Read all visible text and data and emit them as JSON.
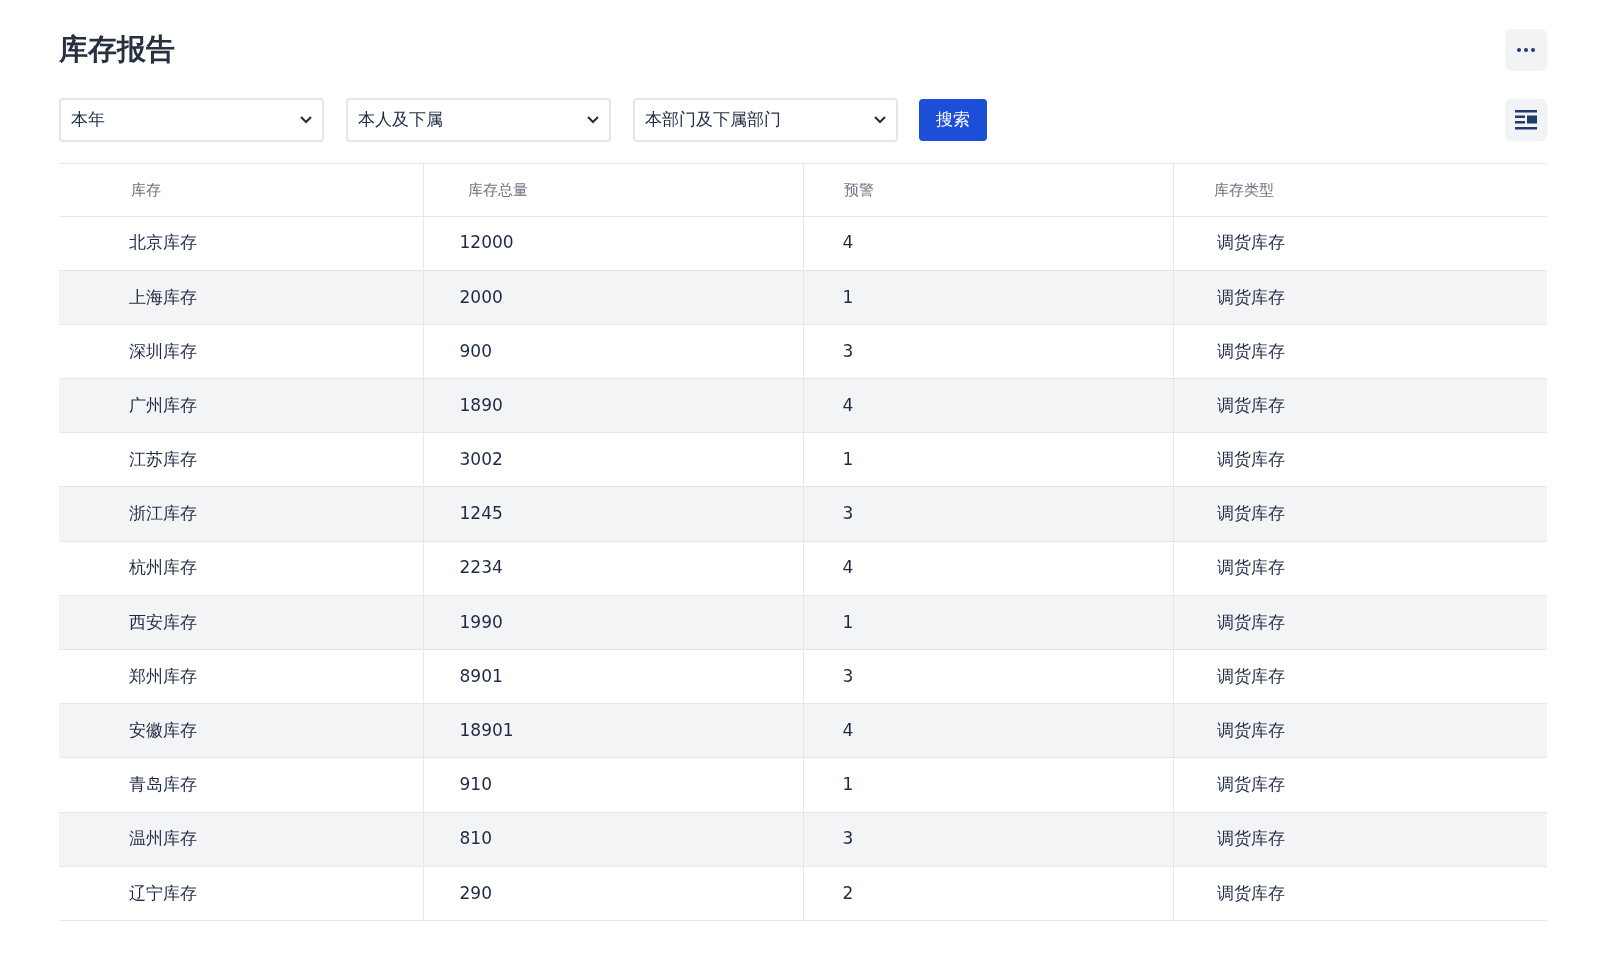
{
  "title": "库存报告",
  "filters": [
    {
      "value": "本年"
    },
    {
      "value": "本人及下属"
    },
    {
      "value": "本部门及下属部门"
    }
  ],
  "search_button": "搜索",
  "table": {
    "columns": [
      "库存",
      "库存总量",
      "预警",
      "库存类型"
    ],
    "rows": [
      [
        "北京库存",
        "12000",
        "4",
        "调货库存"
      ],
      [
        "上海库存",
        "2000",
        "1",
        "调货库存"
      ],
      [
        "深圳库存",
        "900",
        "3",
        "调货库存"
      ],
      [
        "广州库存",
        "1890",
        "4",
        "调货库存"
      ],
      [
        "江苏库存",
        "3002",
        "1",
        "调货库存"
      ],
      [
        "浙江库存",
        "1245",
        "3",
        "调货库存"
      ],
      [
        "杭州库存",
        "2234",
        "4",
        "调货库存"
      ],
      [
        "西安库存",
        "1990",
        "1",
        "调货库存"
      ],
      [
        "郑州库存",
        "8901",
        "3",
        "调货库存"
      ],
      [
        "安徽库存",
        "18901",
        "4",
        "调货库存"
      ],
      [
        "青岛库存",
        "910",
        "1",
        "调货库存"
      ],
      [
        "温州库存",
        "810",
        "3",
        "调货库存"
      ],
      [
        "辽宁库存",
        "290",
        "2",
        "调货库存"
      ]
    ]
  }
}
